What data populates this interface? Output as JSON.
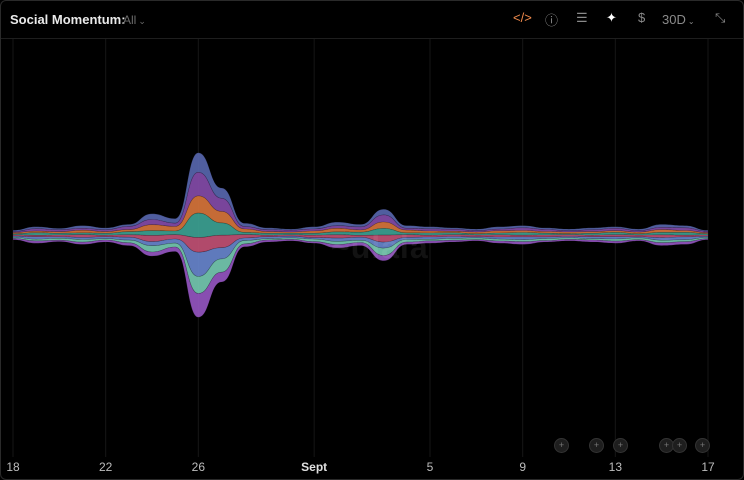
{
  "header": {
    "title": "Social Momentum:",
    "filter": "All",
    "period": "30D"
  },
  "toolbar": {
    "embed_glyph": "</>",
    "info_glyph": "ⓘ",
    "list_glyph": "☰",
    "sparkle_glyph": "✦",
    "dollar_glyph": "$",
    "collapse_glyph": "⤡",
    "chevron_glyph": "⌄"
  },
  "x_ticks": [
    "18",
    "22",
    "26",
    "Sept",
    "5",
    "9",
    "13",
    "17"
  ],
  "event_markers": [
    "+",
    "+",
    "+",
    "+",
    "+",
    "+"
  ],
  "colors": {
    "background": "#000000",
    "accent": "#f08a4b",
    "series": [
      "#5b6bb5",
      "#8a4fb0",
      "#e07a3e",
      "#3fa89a",
      "#c9547a",
      "#6c8bd6",
      "#7ad1b8",
      "#9b59c9"
    ]
  },
  "chart_data": {
    "type": "area",
    "layout": "streamgraph",
    "x": [
      "Aug 18",
      "Aug 19",
      "Aug 20",
      "Aug 21",
      "Aug 22",
      "Aug 23",
      "Aug 24",
      "Aug 25",
      "Aug 26",
      "Aug 27",
      "Aug 28",
      "Aug 29",
      "Aug 30",
      "Aug 31",
      "Sep 1",
      "Sep 2",
      "Sep 3",
      "Sep 4",
      "Sep 5",
      "Sep 6",
      "Sep 7",
      "Sep 8",
      "Sep 9",
      "Sep 10",
      "Sep 11",
      "Sep 12",
      "Sep 13",
      "Sep 14",
      "Sep 15",
      "Sep 16",
      "Sep 17"
    ],
    "total": [
      20,
      35,
      28,
      40,
      30,
      45,
      90,
      70,
      350,
      200,
      50,
      30,
      25,
      35,
      55,
      45,
      110,
      40,
      35,
      30,
      25,
      35,
      40,
      30,
      25,
      30,
      35,
      25,
      45,
      40,
      20
    ],
    "series_colors": [
      "#5b6bb5",
      "#8a4fb0",
      "#e07a3e",
      "#3fa89a",
      "#c9547a",
      "#6c8bd6",
      "#7ad1b8",
      "#9b59c9"
    ],
    "x_tick_labels": [
      "18",
      "22",
      "26",
      "Sept",
      "5",
      "9",
      "13",
      "17"
    ],
    "grid": "vertical"
  }
}
